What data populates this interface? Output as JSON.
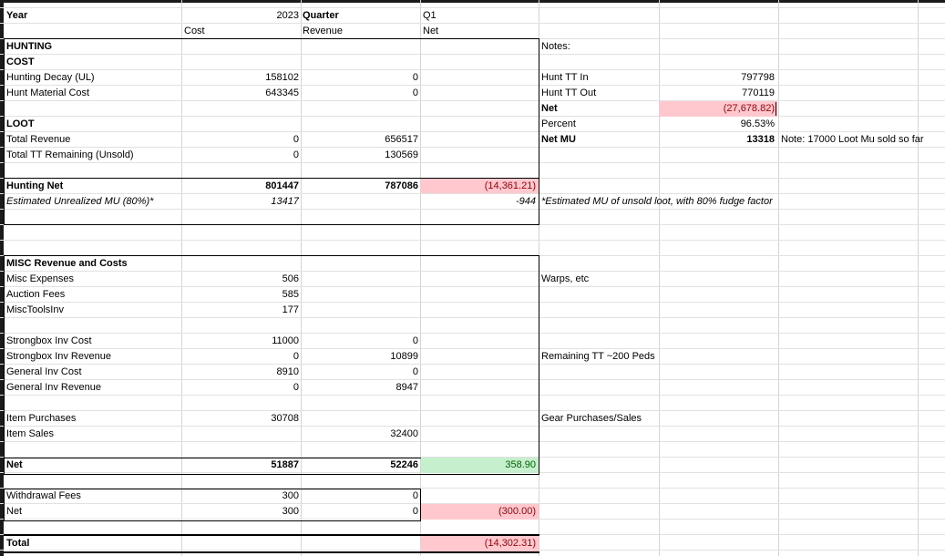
{
  "header": {
    "year_label": "Year",
    "year_value": "2023",
    "quarter_label": "Quarter",
    "quarter_value": "Q1",
    "col_cost": "Cost",
    "col_revenue": "Revenue",
    "col_net": "Net"
  },
  "hunting": {
    "title": "HUNTING",
    "cost_label": "COST",
    "decay_label": "Hunting Decay (UL)",
    "decay_cost": "158102",
    "decay_rev": "0",
    "material_label": "Hunt Material Cost",
    "material_cost": "643345",
    "material_rev": "0",
    "loot_label": "LOOT",
    "total_rev_label": "Total Revenue",
    "total_rev_cost": "0",
    "total_rev_val": "656517",
    "tt_remaining_label": "Total TT Remaining (Unsold)",
    "tt_remaining_cost": "0",
    "tt_remaining_val": "130569",
    "net_label": "Hunting Net",
    "net_cost": "801447",
    "net_rev": "787086",
    "net_value": "(14,361.21)",
    "est_label": "Estimated Unrealized MU (80%)*",
    "est_cost": "13417",
    "est_net": "-944",
    "est_note": "*Estimated MU of unsold loot, with 80% fudge factor"
  },
  "notes": {
    "title": "Notes:",
    "hunt_tt_in_label": "Hunt TT In",
    "hunt_tt_in_val": "797798",
    "hunt_tt_out_label": "Hunt TT Out",
    "hunt_tt_out_val": "770119",
    "net_label": "Net",
    "net_val": "(27,678.82)",
    "percent_label": "Percent",
    "percent_val": "96.53%",
    "net_mu_label": "Net MU",
    "net_mu_val": "13318",
    "net_mu_note": "Note: 17000 Loot Mu sold so far",
    "warps_note": "Warps, etc",
    "remaining_note": "Remaining TT ~200 Peds",
    "gear_note": "Gear Purchases/Sales"
  },
  "misc": {
    "title": "MISC Revenue and Costs",
    "expenses_label": "Misc Expenses",
    "expenses_cost": "506",
    "auction_label": "Auction Fees",
    "auction_cost": "585",
    "tools_label": "MiscToolsInv",
    "tools_cost": "177",
    "sb_cost_label": "Strongbox Inv Cost",
    "sb_cost_cost": "11000",
    "sb_cost_rev": "0",
    "sb_rev_label": "Strongbox Inv Revenue",
    "sb_rev_cost": "0",
    "sb_rev_rev": "10899",
    "gen_cost_label": "General Inv Cost",
    "gen_cost_cost": "8910",
    "gen_cost_rev": "0",
    "gen_rev_label": "General Inv Revenue",
    "gen_rev_cost": "0",
    "gen_rev_rev": "8947",
    "item_purch_label": "Item Purchases",
    "item_purch_cost": "30708",
    "item_sales_label": "Item Sales",
    "item_sales_rev": "32400",
    "net_label": "Net",
    "net_cost": "51887",
    "net_rev": "52246",
    "net_value": "358.90"
  },
  "withdrawal": {
    "fees_label": "Withdrawal Fees",
    "fees_cost": "300",
    "fees_rev": "0",
    "net_label": "Net",
    "net_cost": "300",
    "net_rev": "0",
    "net_value": "(300.00)"
  },
  "total": {
    "label": "Total",
    "value": "(14,302.31)"
  },
  "colors": {
    "negative_fill": "#ffc7ce",
    "negative_text": "#9c0006",
    "positive_fill": "#c6efce",
    "positive_text": "#006100",
    "grid_line": "#d4d4d4"
  }
}
